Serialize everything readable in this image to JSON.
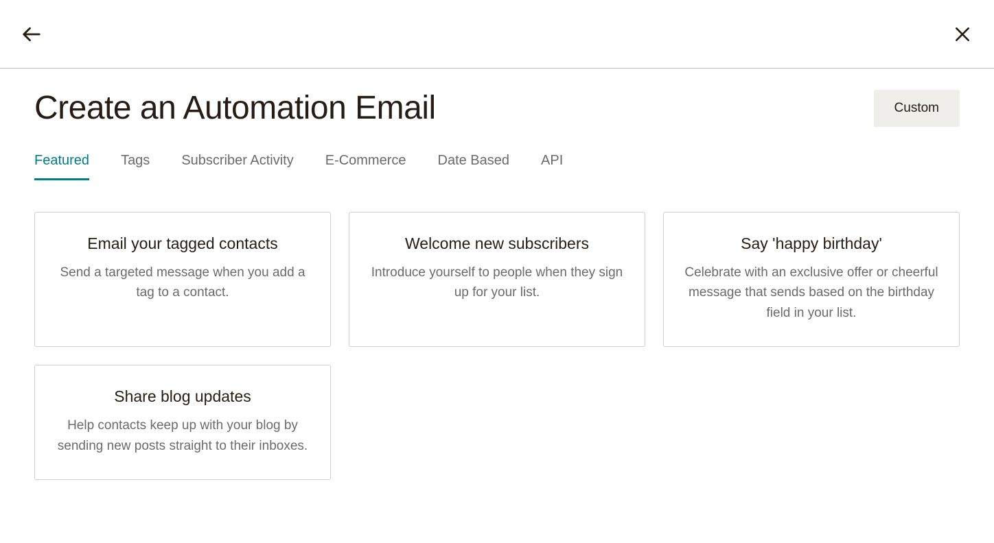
{
  "header": {
    "title": "Create an Automation Email",
    "custom_button_label": "Custom"
  },
  "tabs": [
    {
      "label": "Featured",
      "active": true
    },
    {
      "label": "Tags",
      "active": false
    },
    {
      "label": "Subscriber Activity",
      "active": false
    },
    {
      "label": "E-Commerce",
      "active": false
    },
    {
      "label": "Date Based",
      "active": false
    },
    {
      "label": "API",
      "active": false
    }
  ],
  "cards": [
    {
      "title": "Email your tagged contacts",
      "description": "Send a targeted message when you add a tag to a contact."
    },
    {
      "title": "Welcome new subscribers",
      "description": "Introduce yourself to people when they sign up for your list."
    },
    {
      "title": "Say 'happy birthday'",
      "description": "Celebrate with an exclusive offer or cheerful message that sends based on the birthday field in your list."
    },
    {
      "title": "Share blog updates",
      "description": "Help contacts keep up with your blog by sending new posts straight to their inboxes."
    }
  ]
}
